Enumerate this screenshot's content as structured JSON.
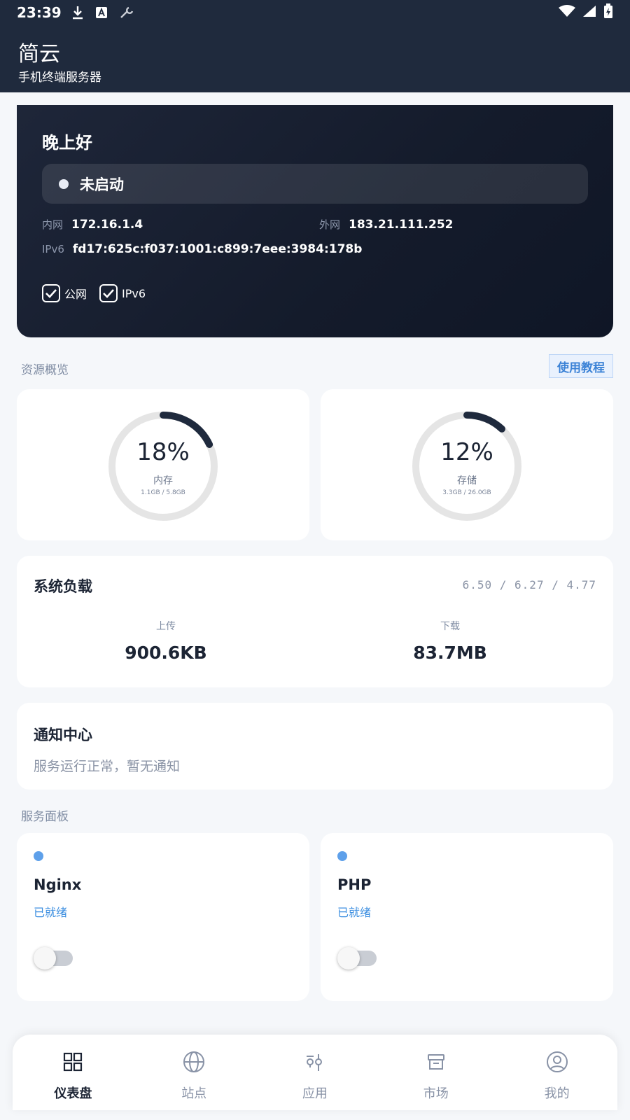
{
  "status_bar": {
    "time": "23:39"
  },
  "app": {
    "title": "简云",
    "subtitle": "手机终端服务器"
  },
  "hero": {
    "greeting": "晚上好",
    "status": "未启动",
    "lan_label": "内网",
    "lan_ip": "172.16.1.4",
    "wan_label": "外网",
    "wan_ip": "183.21.111.252",
    "ipv6_label": "IPv6",
    "ipv6": "fd17:625c:f037:1001:c899:7eee:3984:178b",
    "checkboxes": [
      {
        "label": "公网",
        "checked": true
      },
      {
        "label": "IPv6",
        "checked": true
      }
    ]
  },
  "resources": {
    "section_label": "资源概览",
    "tutorial_label": "使用教程",
    "memory": {
      "percent_text": "18%",
      "percent": 18,
      "name": "内存",
      "detail": "1.1GB / 5.8GB"
    },
    "storage": {
      "percent_text": "12%",
      "percent": 12,
      "name": "存储",
      "detail": "3.3GB / 26.0GB"
    }
  },
  "load": {
    "title": "系统负载",
    "averages": "6.50 / 6.27 / 4.77",
    "upload_label": "上传",
    "upload_value": "900.6KB",
    "download_label": "下载",
    "download_value": "83.7MB"
  },
  "notice": {
    "title": "通知中心",
    "text": "服务运行正常，暂无通知"
  },
  "services": {
    "section_label": "服务面板",
    "items": [
      {
        "name": "Nginx",
        "state": "已就绪",
        "enabled": false
      },
      {
        "name": "PHP",
        "state": "已就绪",
        "enabled": false
      }
    ]
  },
  "nav": {
    "items": [
      {
        "label": "仪表盘",
        "icon": "dashboard-icon",
        "active": true
      },
      {
        "label": "站点",
        "icon": "globe-icon",
        "active": false
      },
      {
        "label": "应用",
        "icon": "apps-icon",
        "active": false
      },
      {
        "label": "市场",
        "icon": "store-icon",
        "active": false
      },
      {
        "label": "我的",
        "icon": "profile-icon",
        "active": false
      }
    ]
  },
  "colors": {
    "accent": "#1f2a3d",
    "link": "#3b8ee0",
    "gauge_track": "#e5e5e5",
    "gauge_fill": "#1f2a3d"
  }
}
